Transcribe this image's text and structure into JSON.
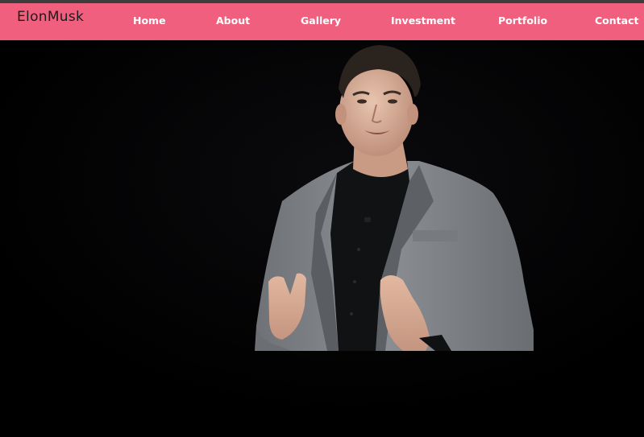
{
  "brand": {
    "logo_text": "ElonMusk"
  },
  "nav": {
    "items": [
      {
        "label": "Home"
      },
      {
        "label": "About"
      },
      {
        "label": "Gallery"
      },
      {
        "label": "Investment"
      },
      {
        "label": "Portfolio"
      },
      {
        "label": "Contact"
      }
    ]
  },
  "hero": {
    "image": "portrait-photo"
  },
  "colors": {
    "navbar": "#f0607e",
    "nav_text": "#ffffff",
    "logo_text": "#1c1c1c",
    "page_background": "#000000",
    "top_strip": "#3d3d3d"
  }
}
